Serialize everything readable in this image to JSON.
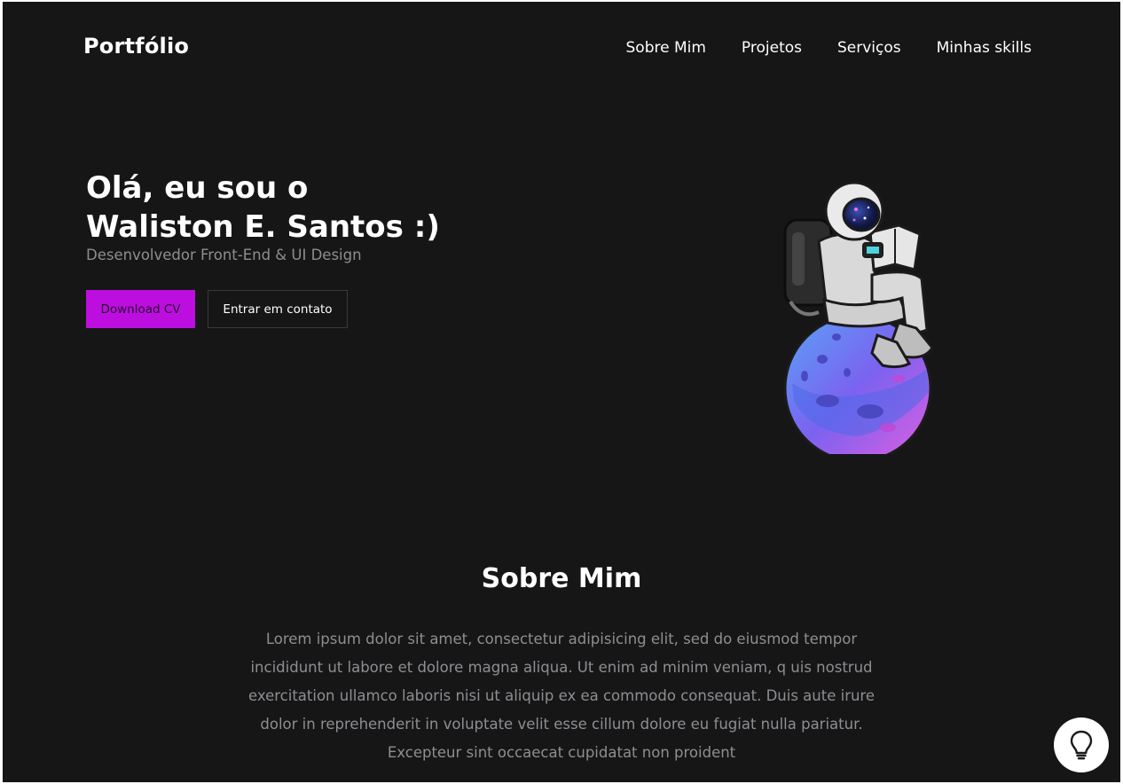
{
  "header": {
    "logo": "Portfólio",
    "nav": [
      "Sobre Mim",
      "Projetos",
      "Serviços",
      "Minhas skills"
    ]
  },
  "hero": {
    "title_line1": "Olá, eu sou o",
    "title_line2": "Waliston E. Santos :)",
    "subtitle": "Desenvolvedor Front-End & UI Design",
    "primary_button": "Download CV",
    "secondary_button": "Entrar em contato",
    "illustration": "astronaut-on-planet"
  },
  "about": {
    "title": "Sobre Mim",
    "text": "Lorem ipsum dolor sit amet, consectetur adipisicing elit, sed do eiusmod tempor incididunt ut labore et dolore magna aliqua. Ut enim ad minim veniam, q uis nostrud exercitation ullamco laboris nisi ut aliquip ex ea commodo consequat. Duis aute irure dolor in reprehenderit in voluptate velit esse cillum dolore eu fugiat nulla pariatur. Excepteur sint occaecat cupidatat non proident"
  },
  "help_button": {
    "icon": "lightbulb-icon"
  },
  "colors": {
    "background": "#161617",
    "accent": "#bd0ee0",
    "text_muted": "#8e8e93"
  }
}
